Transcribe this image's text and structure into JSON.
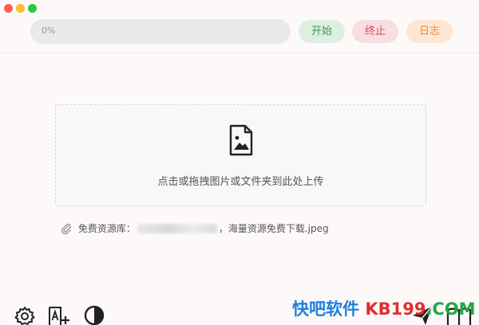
{
  "window": {
    "controls": [
      "close",
      "minimize",
      "zoom"
    ]
  },
  "toolbar": {
    "progress_text": "0%",
    "progress_fraction": 0,
    "start_label": "开始",
    "stop_label": "终止",
    "log_label": "日志"
  },
  "dropzone": {
    "icon": "file-image-icon",
    "hint": "点击或拖拽图片或文件夹到此处上传"
  },
  "file": {
    "prefix": "免费资源库：",
    "suffix": "，海量资源免费下载.jpeg"
  },
  "bottom_icons": [
    "gear-icon",
    "font-size-icon",
    "contrast-icon",
    "send-icon",
    "book-icon"
  ],
  "watermark": {
    "part1": "快吧软件",
    "part2": "KB199",
    "part3": ".COM"
  },
  "colors": {
    "start": "#3d9a5c",
    "stop": "#d6485d",
    "log": "#e78b3f",
    "watermark_blue": "#1e7fe0",
    "watermark_red": "#e02d2d",
    "watermark_green": "#22a844"
  }
}
